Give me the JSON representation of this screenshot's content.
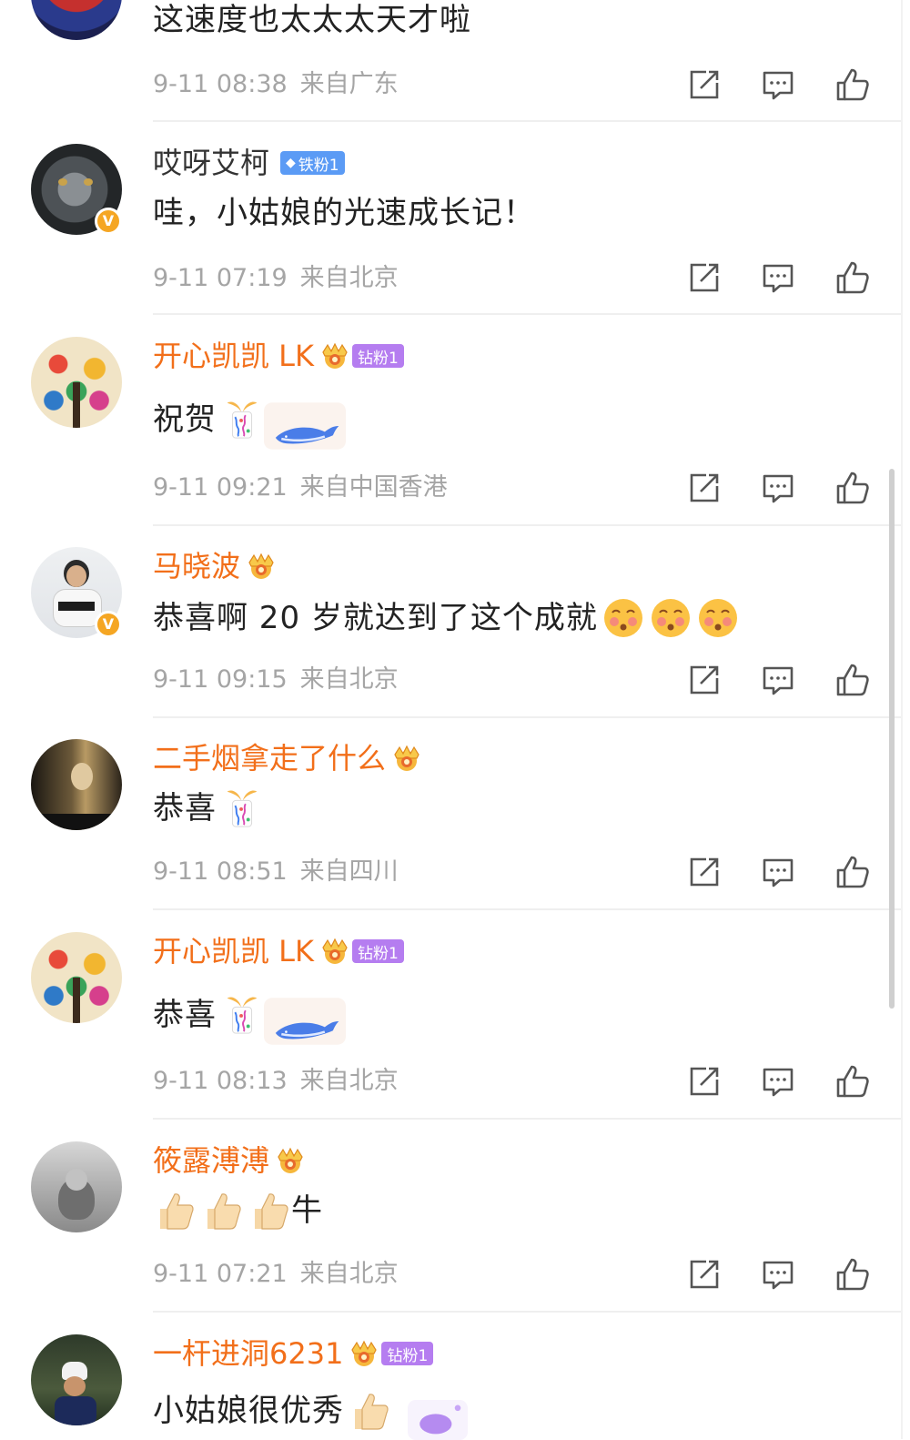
{
  "comments": [
    {
      "user": "",
      "text": "这速度也太太太天才啦",
      "date": "9-11 08:38",
      "location": "来自广东"
    },
    {
      "user": "哎呀艾柯",
      "badge": "铁粉1",
      "text": "哇，小姑娘的光速成长记！",
      "date": "9-11 07:19",
      "location": "来自北京"
    },
    {
      "user": "开心凯凯 LK",
      "badge": "钻粉1",
      "text": "祝贺",
      "date": "9-11 09:21",
      "location": "来自中国香港"
    },
    {
      "user": "马晓波",
      "text": "恭喜啊 20 岁就达到了这个成就",
      "date": "9-11 09:15",
      "location": "来自北京"
    },
    {
      "user": "二手烟拿走了什么",
      "text": "恭喜",
      "date": "9-11 08:51",
      "location": "来自四川"
    },
    {
      "user": "开心凯凯 LK",
      "badge": "钻粉1",
      "text": "恭喜",
      "date": "9-11 08:13",
      "location": "来自北京"
    },
    {
      "user": "筱露溥溥",
      "text": "牛",
      "date": "9-11 07:21",
      "location": "来自北京"
    },
    {
      "user": "一杆进洞6231",
      "badge": "钻粉1",
      "text": "小姑娘很优秀"
    }
  ],
  "icons": [
    "share-icon",
    "reply-icon",
    "like-icon",
    "crown-icon",
    "party-popper-emoji",
    "whale-sticker",
    "blush-emoji",
    "thumbs-up-emoji",
    "verified-icon"
  ],
  "colors": {
    "vip_name": "#f26f1a",
    "meta": "#a5a5a5",
    "iron_badge": "#5b9bf5",
    "diamond_badge": "#b57df0",
    "verified": "#f5a623"
  }
}
